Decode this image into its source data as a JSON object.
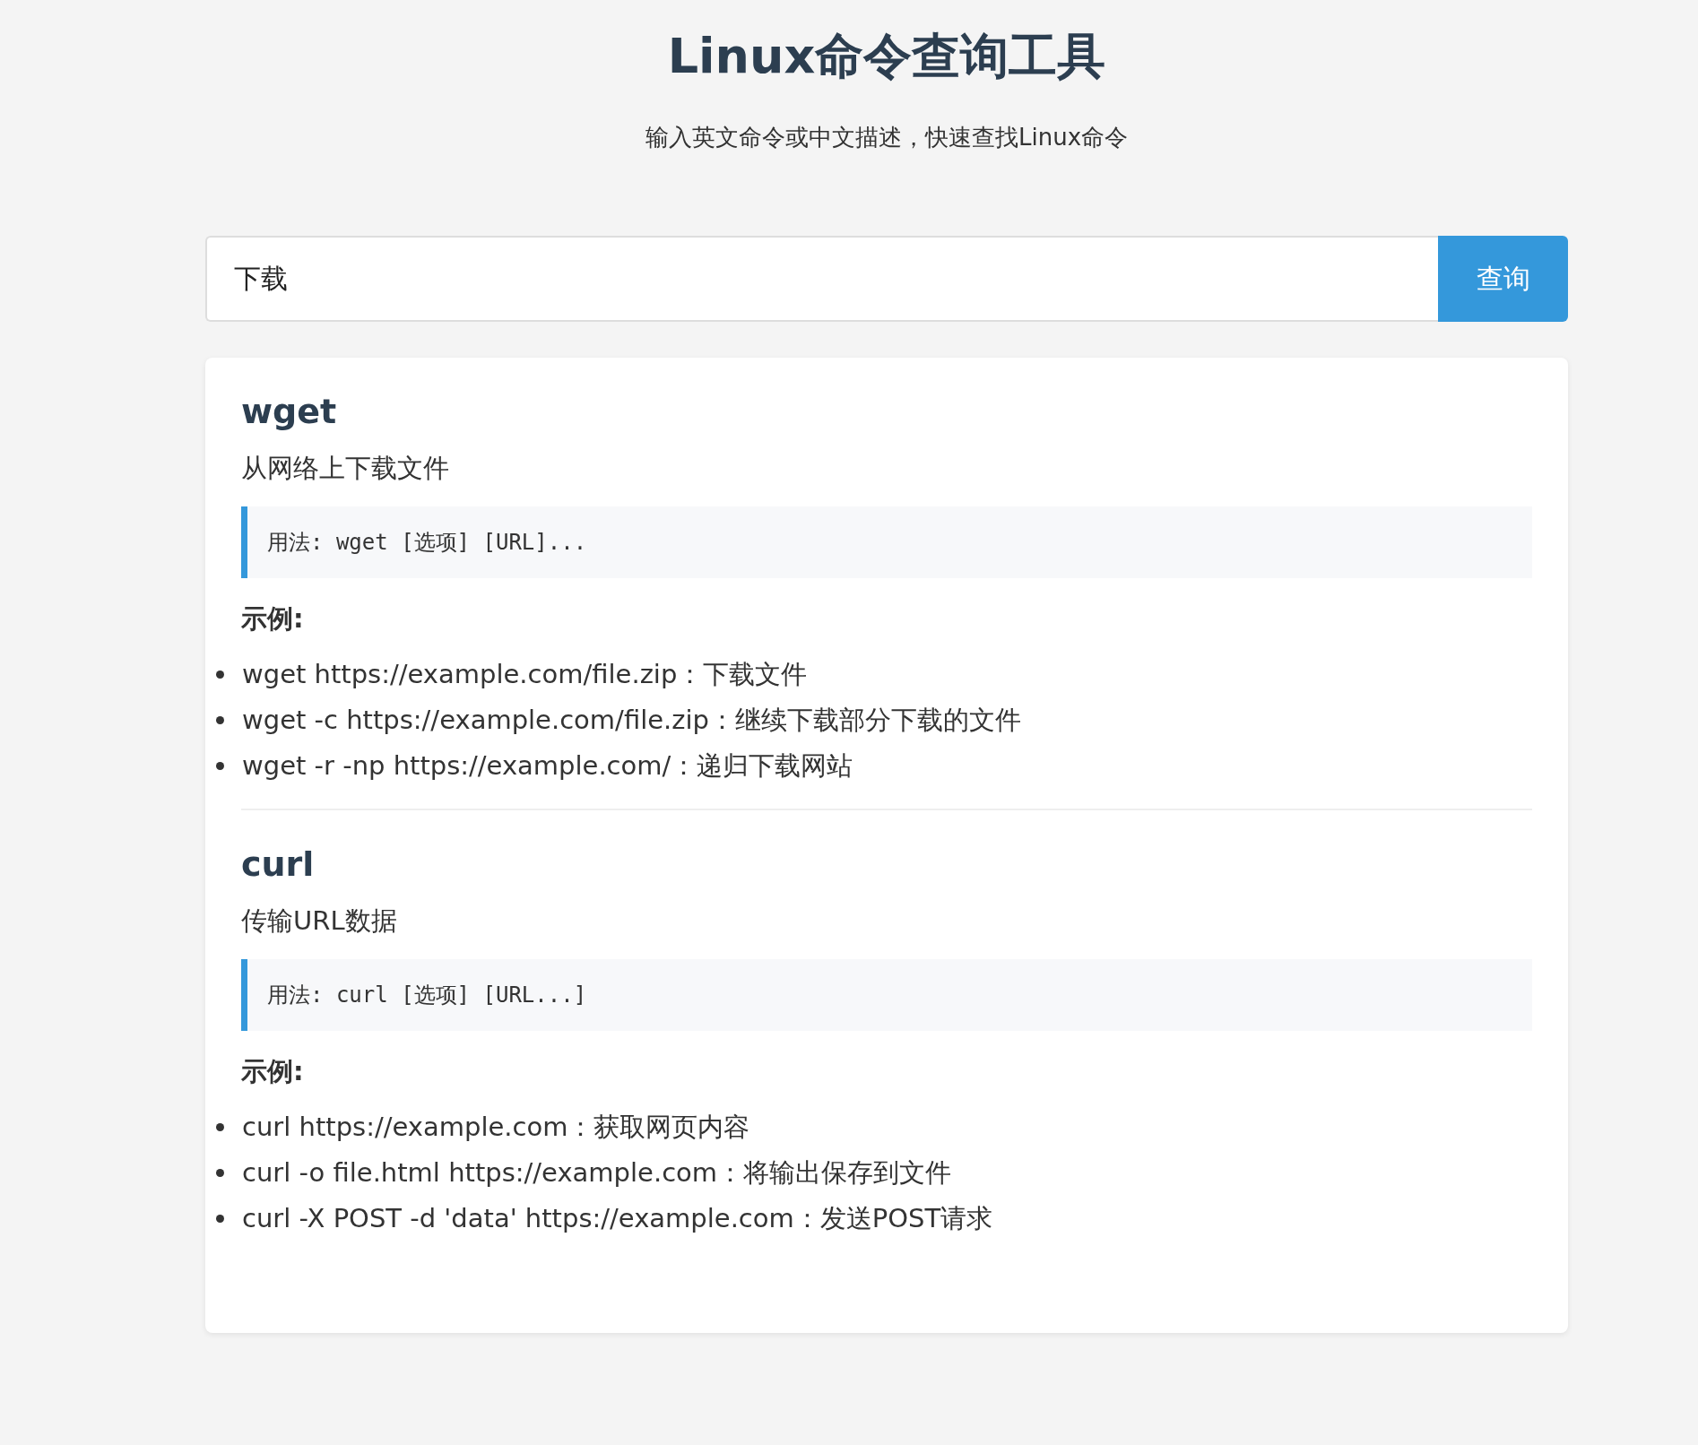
{
  "header": {
    "title": "Linux命令查询工具",
    "subtitle": "输入英文命令或中文描述，快速查找Linux命令"
  },
  "search": {
    "value": "下载",
    "button": "查询"
  },
  "results": [
    {
      "name": "wget",
      "description": "从网络上下载文件",
      "usage": "用法: wget [选项] [URL]...",
      "examples_label": "示例:",
      "examples": [
        "wget https://example.com/file.zip：下载文件",
        "wget -c https://example.com/file.zip：继续下载部分下载的文件",
        "wget -r -np https://example.com/：递归下载网站"
      ]
    },
    {
      "name": "curl",
      "description": "传输URL数据",
      "usage": "用法: curl [选项] [URL...]",
      "examples_label": "示例:",
      "examples": [
        "curl https://example.com：获取网页内容",
        "curl -o file.html https://example.com：将输出保存到文件",
        "curl -X POST -d 'data' https://example.com：发送POST请求"
      ]
    }
  ]
}
